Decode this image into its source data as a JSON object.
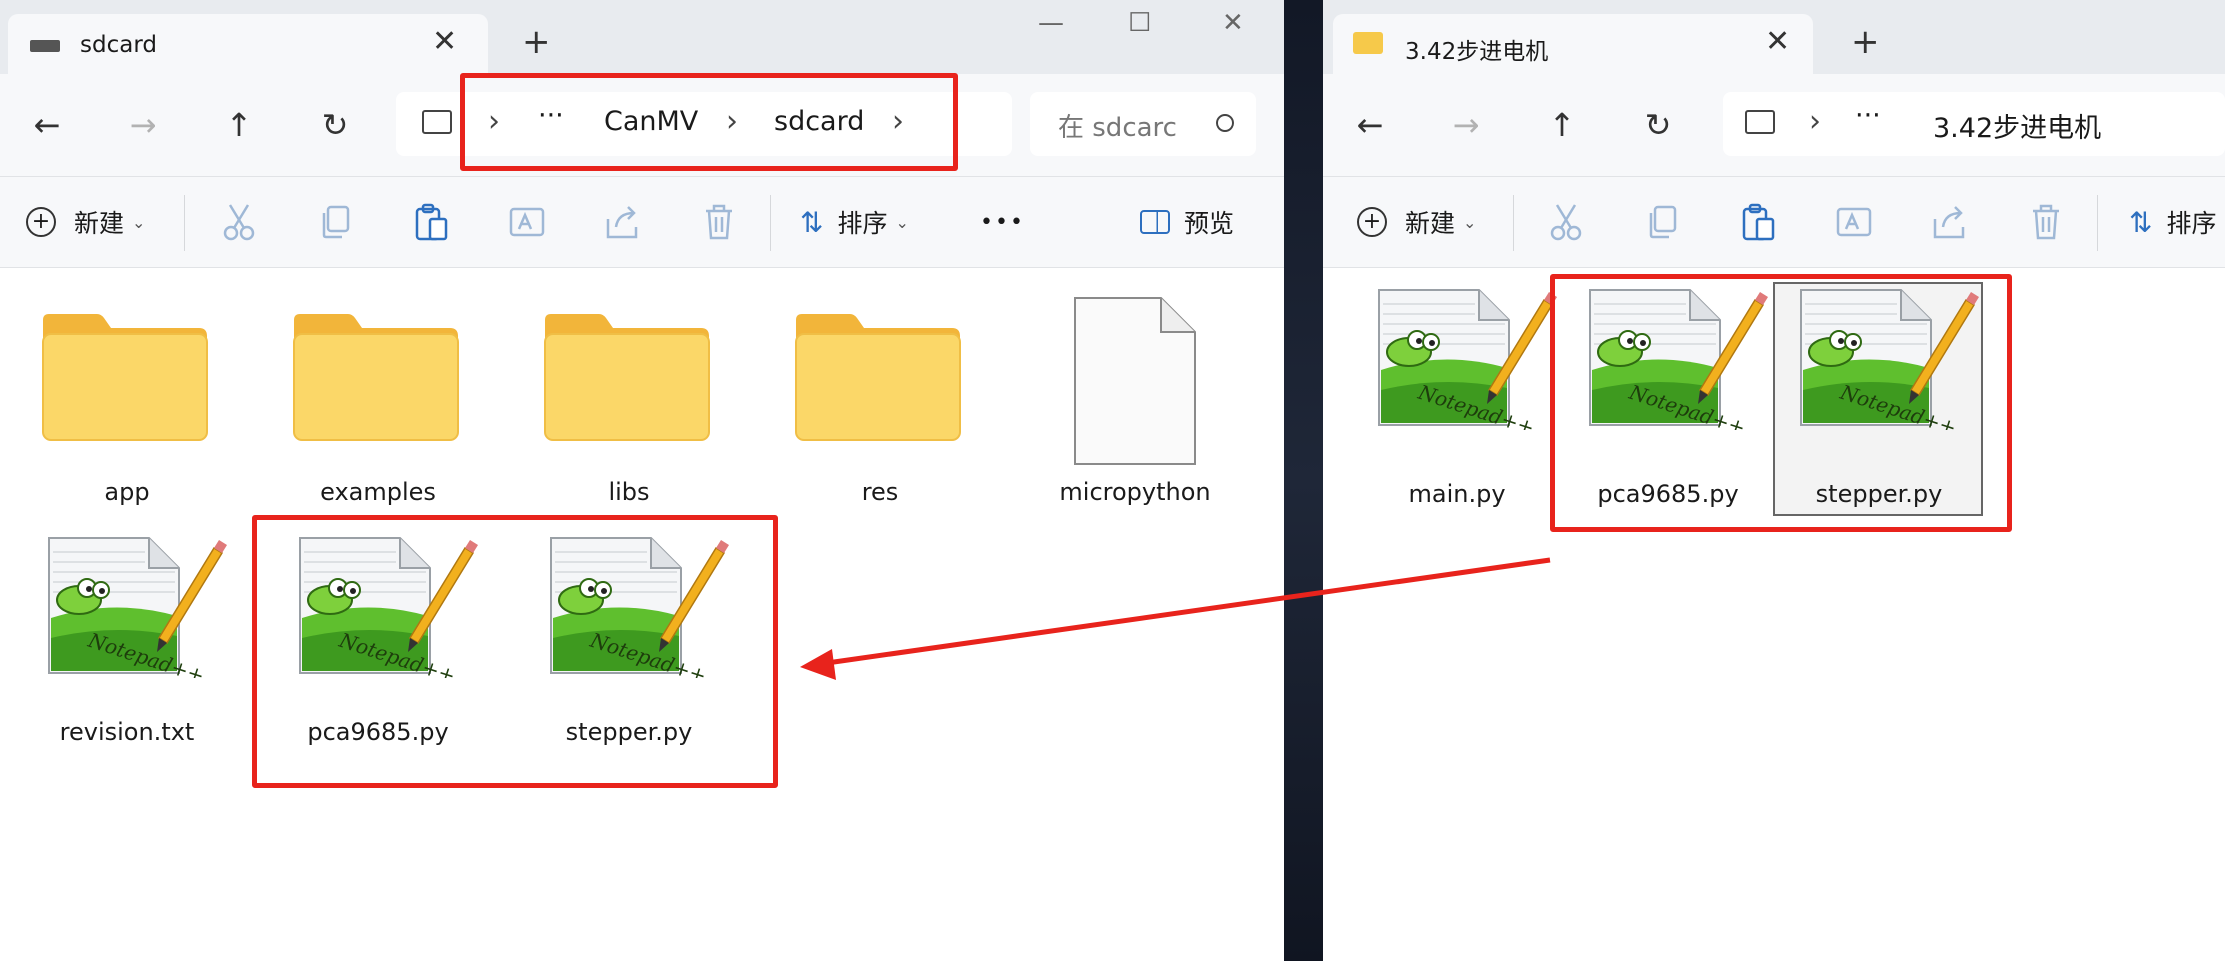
{
  "left_window": {
    "tab_title": "sdcard",
    "breadcrumb": [
      "CanMV",
      "sdcard"
    ],
    "overflow": "···",
    "search_placeholder": "在 sdcarc",
    "toolbar": {
      "new_label": "新建",
      "sort_label": "排序",
      "more": "•••",
      "preview_label": "预览"
    },
    "items": [
      {
        "name": "app",
        "type": "folder"
      },
      {
        "name": "examples",
        "type": "folder"
      },
      {
        "name": "libs",
        "type": "folder"
      },
      {
        "name": "res",
        "type": "folder"
      },
      {
        "name": "micropython",
        "type": "file"
      },
      {
        "name": "revision.txt",
        "type": "notepad"
      },
      {
        "name": "pca9685.py",
        "type": "notepad"
      },
      {
        "name": "stepper.py",
        "type": "notepad"
      }
    ]
  },
  "right_window": {
    "tab_title": "3.42步进电机",
    "breadcrumb": [
      "3.42步进电机"
    ],
    "overflow": "···",
    "toolbar": {
      "new_label": "新建",
      "sort_label": "排序"
    },
    "items": [
      {
        "name": "main.py",
        "type": "notepad"
      },
      {
        "name": "pca9685.py",
        "type": "notepad"
      },
      {
        "name": "stepper.py",
        "type": "notepad",
        "selected": true
      }
    ]
  },
  "icons": {
    "back": "←",
    "forward": "→",
    "up": "↑",
    "refresh": "↻",
    "chevron": "›",
    "close": "✕",
    "plus": "+",
    "minimize": "—",
    "maximize": "☐"
  },
  "colors": {
    "annotation_red": "#e8231c",
    "folder": "#f6c94a"
  }
}
